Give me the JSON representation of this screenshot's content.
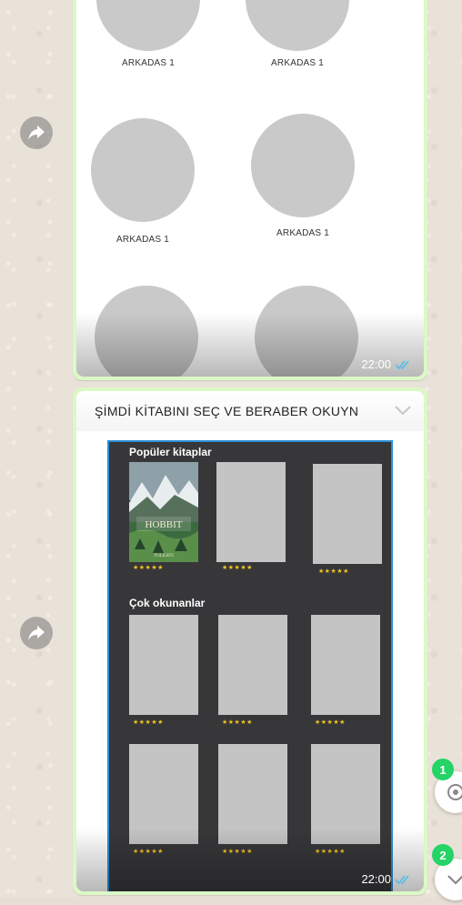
{
  "friends_message": {
    "friend_labels": [
      "ARKADAS 1",
      "ARKADAS 1",
      "ARKADAS 1",
      "ARKADAS 1"
    ],
    "time": "22:00"
  },
  "books_message": {
    "caption": "ŞİMDİ KİTABINI SEÇ VE BERABER OKUYN",
    "popular_title": "Popüler kitaplar",
    "most_read_title": "Çok okunanlar",
    "time": "22:00",
    "rating_text": "★★★★★"
  },
  "floating_badges": [
    "1",
    "2"
  ],
  "colors": {
    "bubble_green": "#dcf8c6",
    "read_tick_blue": "#53bdeb",
    "badge_green": "#25d366",
    "phone_dark": "#37373a"
  },
  "icons": [
    "forward-icon",
    "chevron-down-icon",
    "double-check-icon",
    "mention-icon",
    "scroll-down-icon"
  ]
}
